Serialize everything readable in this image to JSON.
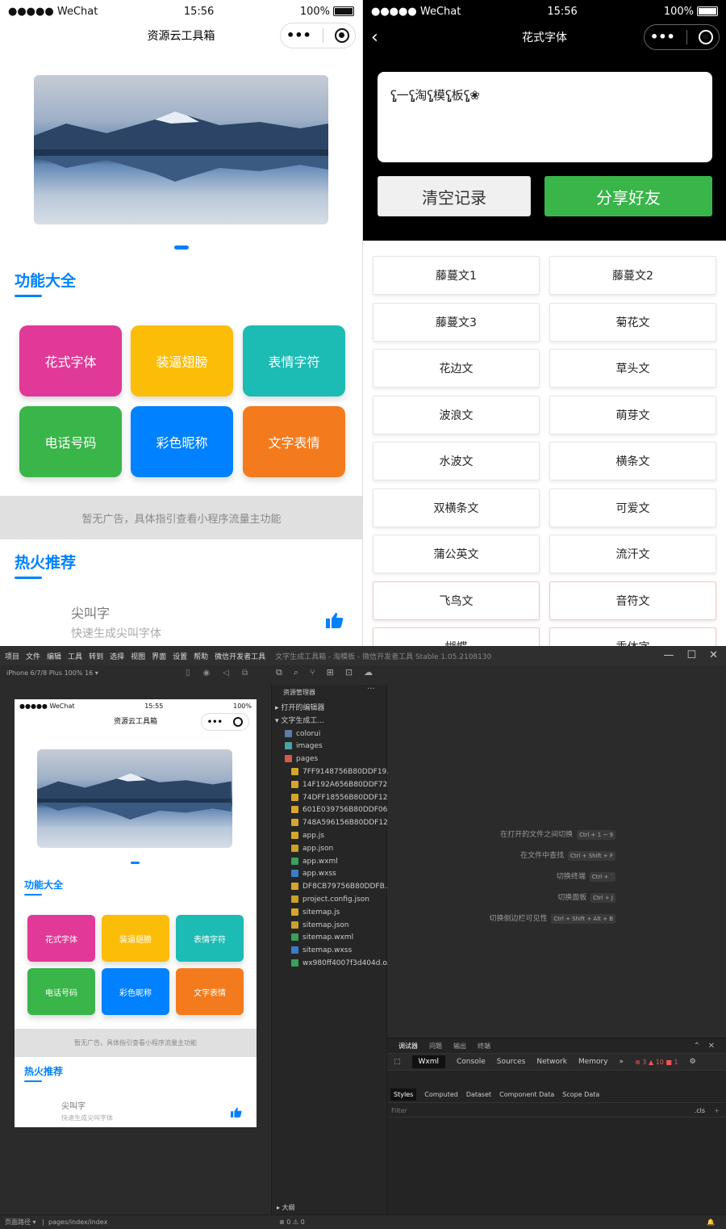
{
  "phone1": {
    "status": {
      "carrier": "●●●●● WeChat",
      "time": "15:56",
      "battery": "100%"
    },
    "title": "资源云工具箱",
    "section1_title": "功能大全",
    "tiles": [
      {
        "label": "花式字体",
        "color": "#e03997"
      },
      {
        "label": "装逼翅膀",
        "color": "#fbbd08"
      },
      {
        "label": "表情字符",
        "color": "#1cbbb4"
      },
      {
        "label": "电话号码",
        "color": "#39b54a"
      },
      {
        "label": "彩色昵称",
        "color": "#0081ff"
      },
      {
        "label": "文字表情",
        "color": "#f37b1d"
      }
    ],
    "ad_text": "暂无广告，具体指引查看小程序流量主功能",
    "section2_title": "热火推荐",
    "rec_title": "尖叫字",
    "rec_desc": "快速生成尖叫字体",
    "like_icon": "thumbs-up-icon"
  },
  "phone2": {
    "status": {
      "carrier": "●●●●● WeChat",
      "time": "15:56",
      "battery": "100%"
    },
    "title": "花式字体",
    "sample_text": "ʕ̡̢̡一ʕ̡̢̡淘ʕ̡̢̡模ʕ̡̢̡板ʕ̡̢̡❀",
    "clear_btn": "清空记录",
    "share_btn": "分享好友",
    "fonts": [
      "藤蔓文1",
      "藤蔓文2",
      "藤蔓文3",
      "菊花文",
      "花边文",
      "草头文",
      "波浪文",
      "萌芽文",
      "水波文",
      "横条文",
      "双横条文",
      "可爱文",
      "蒲公英文",
      "流汗文",
      "飞鸟文",
      "音符文",
      "蝴蝶",
      "乖体字"
    ]
  },
  "ide": {
    "menu": [
      "项目",
      "文件",
      "编辑",
      "工具",
      "转到",
      "选择",
      "视图",
      "界面",
      "设置",
      "帮助",
      "微信开发者工具"
    ],
    "window_title": "文字生成工具箱 - 淘模板 - 微信开发者工具 Stable 1.05.2108130",
    "device": "iPhone 6/7/8 Plus 100% 16 ▾",
    "sim": {
      "carrier": "●●●●● WeChat",
      "time": "15:55",
      "battery": "100%",
      "title": "资源云工具箱",
      "section1_title": "功能大全",
      "ad_text": "暂无广告，具体指引查看小程序流量主功能",
      "section2_title": "热火推荐",
      "rec_title": "尖叫字",
      "rec_desc": "快速生成尖叫字体"
    },
    "explorer_title": "资源管理器",
    "explorer": [
      {
        "name": "▸ 打开的编辑器",
        "color": ""
      },
      {
        "name": "▾ 文字生成工...",
        "color": ""
      },
      {
        "name": "colorui",
        "color": "#5a7ea6"
      },
      {
        "name": "images",
        "color": "#4aa3a3"
      },
      {
        "name": "pages",
        "color": "#d35b4a"
      },
      {
        "name": "7FF9148756B80DDF19...",
        "color": "#d6a62a"
      },
      {
        "name": "14F192A656B80DDF72...",
        "color": "#d6a62a"
      },
      {
        "name": "74DFF18556B80DDF12...",
        "color": "#d6a62a"
      },
      {
        "name": "601E039756B80DDF06...",
        "color": "#d6a62a"
      },
      {
        "name": "748A596156B80DDF12...",
        "color": "#d6a62a"
      },
      {
        "name": "app.js",
        "color": "#d6a62a"
      },
      {
        "name": "app.json",
        "color": "#c9a227"
      },
      {
        "name": "app.wxml",
        "color": "#3aa05a"
      },
      {
        "name": "app.wxss",
        "color": "#3b7cc9"
      },
      {
        "name": "DF8CB79756B80DDFB...",
        "color": "#d6a62a"
      },
      {
        "name": "project.config.json",
        "color": "#c9a227"
      },
      {
        "name": "sitemap.js",
        "color": "#d6a62a"
      },
      {
        "name": "sitemap.json",
        "color": "#c9a227"
      },
      {
        "name": "sitemap.wxml",
        "color": "#3aa05a"
      },
      {
        "name": "sitemap.wxss",
        "color": "#3b7cc9"
      },
      {
        "name": "wx980ff4007f3d404d.o...",
        "color": "#3aa05a"
      }
    ],
    "outline": "▸ 大纲",
    "problems": "⊗ 0 ⚠ 0",
    "shortcuts": [
      {
        "label": "在打开的文件之间切换",
        "keys": "Ctrl + 1 ~ 9"
      },
      {
        "label": "在文件中查找",
        "keys": "Ctrl + Shift + F"
      },
      {
        "label": "切换终端",
        "keys": "Ctrl + `"
      },
      {
        "label": "切换面板",
        "keys": "Ctrl + J"
      },
      {
        "label": "切换侧边栏可见性",
        "keys": "Ctrl + Shift + Alt + B"
      }
    ],
    "debug_tabs": [
      "调试器",
      "问题",
      "输出",
      "终端"
    ],
    "debug_tools": [
      "Wxml",
      "Console",
      "Sources",
      "Network",
      "Memory",
      "»"
    ],
    "counts": "⊗ 3 ▲ 10 ■ 1",
    "sub_tabs": [
      "Styles",
      "Computed",
      "Dataset",
      "Component Data",
      "Scope Data"
    ],
    "filter": "Filter",
    "cls": ".cls",
    "status_left": "页面路径 ▾",
    "status_path": "pages/index/index"
  }
}
